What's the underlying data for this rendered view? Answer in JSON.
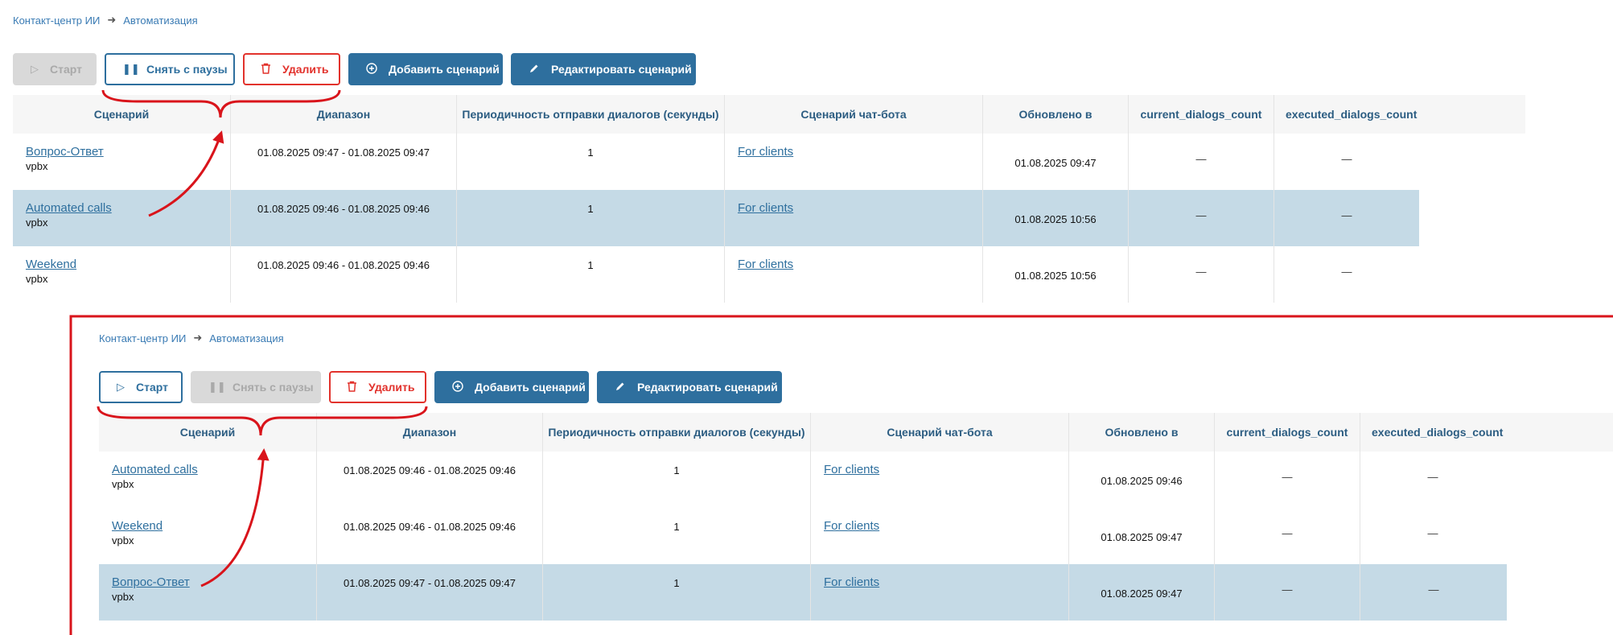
{
  "breadcrumb": {
    "root": "Контакт-центр ИИ",
    "current": "Автоматизация"
  },
  "buttons": {
    "start": "Старт",
    "unpause": "Снять с паузы",
    "delete": "Удалить",
    "add": "Добавить сценарий",
    "edit": "Редактировать сценарий"
  },
  "columns": [
    "Сценарий",
    "Диапазон",
    "Периодичность отправки диалогов (секунды)",
    "Сценарий чат-бота",
    "Обновлено в",
    "current_dialogs_count",
    "executed_dialogs_count"
  ],
  "top_table": {
    "rows": [
      {
        "name": "Вопрос-Ответ",
        "sub": "vpbx",
        "range": "01.08.2025 09:47 - 01.08.2025 09:47",
        "period": "1",
        "bot": "For clients",
        "updated": "01.08.2025 09:47",
        "current": "—",
        "executed": "—",
        "selected": false
      },
      {
        "name": "Automated calls",
        "sub": "vpbx",
        "range": "01.08.2025 09:46 - 01.08.2025 09:46",
        "period": "1",
        "bot": "For clients",
        "updated": "01.08.2025 10:56",
        "current": "—",
        "executed": "—",
        "selected": true
      },
      {
        "name": "Weekend",
        "sub": "vpbx",
        "range": "01.08.2025 09:46 - 01.08.2025 09:46",
        "period": "1",
        "bot": "For clients",
        "updated": "01.08.2025 10:56",
        "current": "—",
        "executed": "—",
        "selected": false
      }
    ]
  },
  "bottom_table": {
    "rows": [
      {
        "name": "Automated calls",
        "sub": "vpbx",
        "range": "01.08.2025 09:46 - 01.08.2025 09:46",
        "period": "1",
        "bot": "For clients",
        "updated": "01.08.2025 09:46",
        "current": "—",
        "executed": "—",
        "selected": false
      },
      {
        "name": "Weekend",
        "sub": "vpbx",
        "range": "01.08.2025 09:46 - 01.08.2025 09:46",
        "period": "1",
        "bot": "For clients",
        "updated": "01.08.2025 09:47",
        "current": "—",
        "executed": "—",
        "selected": false
      },
      {
        "name": "Вопрос-Ответ",
        "sub": "vpbx",
        "range": "01.08.2025 09:47 - 01.08.2025 09:47",
        "period": "1",
        "bot": "For clients",
        "updated": "01.08.2025 09:47",
        "current": "—",
        "executed": "—",
        "selected": true
      }
    ]
  },
  "colors": {
    "primary": "#2e6f9e",
    "danger": "#e2322c",
    "selected_row": "#c5dae6",
    "annotation": "#d9141b"
  }
}
